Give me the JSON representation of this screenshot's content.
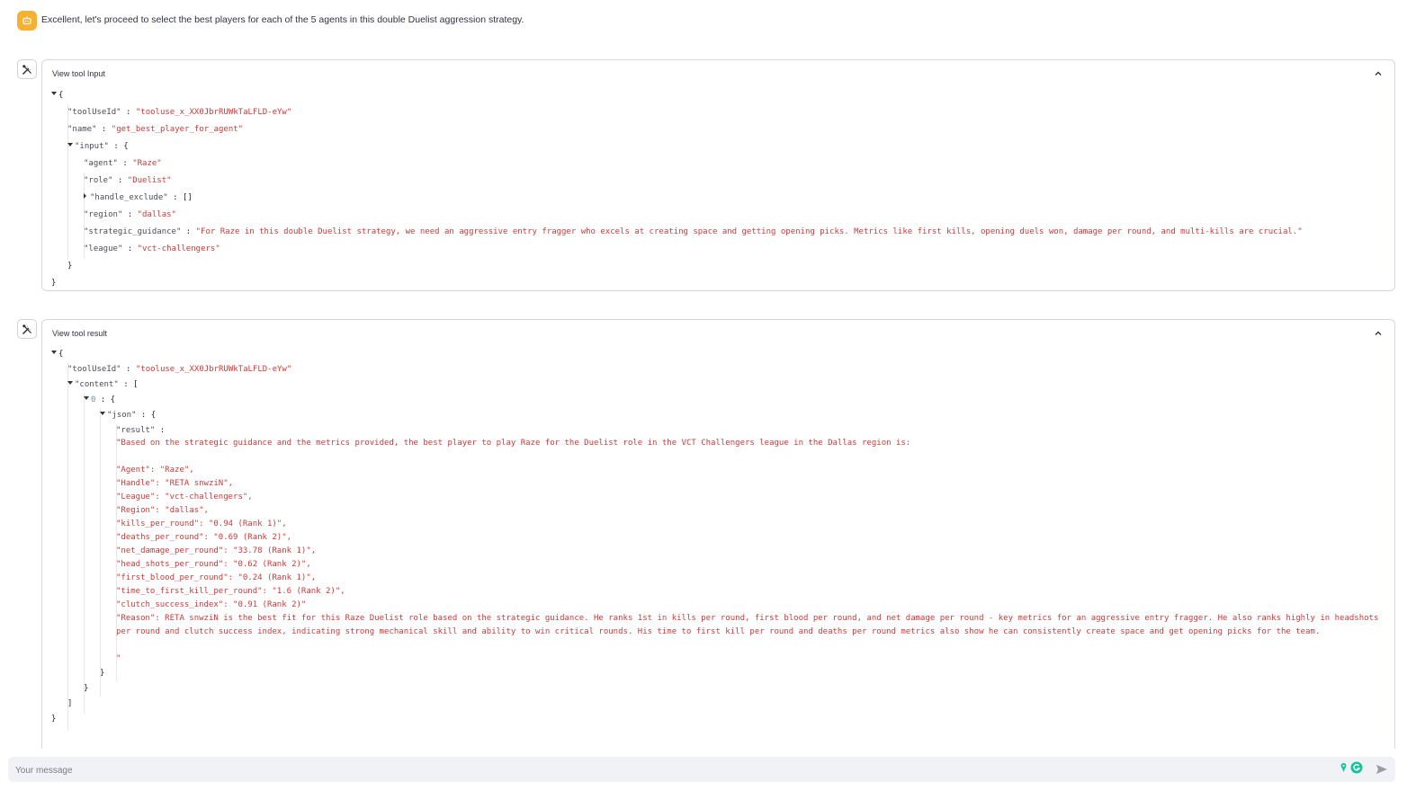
{
  "assistant_message": "Excellent, let's proceed to select the best players for each of the 5 agents in this double Duelist aggression strategy.",
  "tool_input": {
    "title": "View tool Input",
    "toolUseId_key": "\"toolUseId\"",
    "toolUseId_val": "\"tooluse_x_XX0JbrRUWkTaLFLD-eYw\"",
    "name_key": "\"name\"",
    "name_val": "\"get_best_player_for_agent\"",
    "input_key": "\"input\"",
    "agent_key": "\"agent\"",
    "agent_val": "\"Raze\"",
    "role_key": "\"role\"",
    "role_val": "\"Duelist\"",
    "handle_exclude_key": "\"handle_exclude\"",
    "handle_exclude_val": "[]",
    "region_key": "\"region\"",
    "region_val": "\"dallas\"",
    "guidance_key": "\"strategic_guidance\"",
    "guidance_val": "\"For Raze in this double Duelist strategy, we need an aggressive entry fragger who excels at creating space and getting opening picks. Metrics like first kills, opening duels won, damage per round, and multi-kills are crucial.\"",
    "league_key": "\"league\"",
    "league_val": "\"vct-challengers\""
  },
  "tool_result": {
    "title": "View tool result",
    "toolUseId_key": "\"toolUseId\"",
    "toolUseId_val": "\"tooluse_x_XX0JbrRUWkTaLFLD-eYw\"",
    "content_key": "\"content\"",
    "index_key": "0",
    "json_key": "\"json\"",
    "result_key": "\"result\"",
    "result_text": "\"Based on the strategic guidance and the metrics provided, the best player to play Raze for the Duelist role in the VCT Challengers league in the Dallas region is:\n\n\"Agent\": \"Raze\",\n\"Handle\": \"RETA snwziN\",\n\"League\": \"vct-challengers\",\n\"Region\": \"dallas\",\n\"kills_per_round\": \"0.94 (Rank 1)\",\n\"deaths_per_round\": \"0.69 (Rank 2)\",\n\"net_damage_per_round\": \"33.78 (Rank 1)\",\n\"head_shots_per_round\": \"0.62 (Rank 2)\",\n\"first_blood_per_round\": \"0.24 (Rank 1)\",\n\"time_to_first_kill_per_round\": \"1.6 (Rank 2)\",\n\"clutch_success_index\": \"0.91 (Rank 2)\"\n\"Reason\": RETA snwziN is the best fit for this Raze Duelist role based on the strategic guidance. He ranks 1st in kills per round, first blood per round, and net damage per round - key metrics for an aggressive entry fragger. He also ranks highly in headshots per round and clutch success index, indicating strong mechanical skill and ability to win critical rounds. His time to first kill per round and deaths per round metrics also show he can consistently create space and get opening picks for the team.\n\n\""
  },
  "chat_input": {
    "placeholder": "Your message"
  },
  "colors": {
    "accent": "#f6b132",
    "string": "#cb3a3a",
    "grammarly": "#15c39a"
  },
  "icons": [
    "bot-icon",
    "tools-icon",
    "chevron-up-icon",
    "grammarly-icon",
    "send-icon"
  ]
}
